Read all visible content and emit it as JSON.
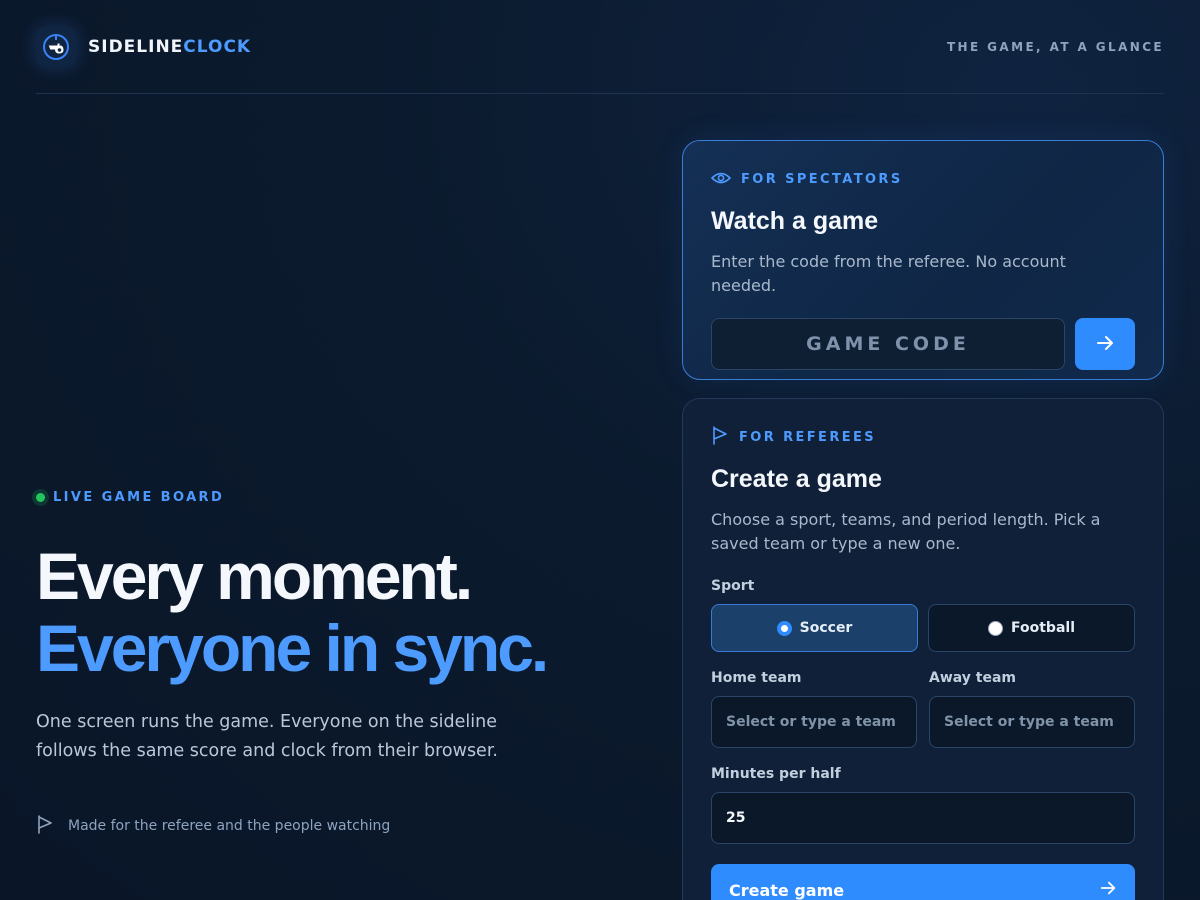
{
  "header": {
    "brand_part1": "SIDELINE",
    "brand_part2": "CLOCK",
    "tagline": "THE GAME, AT A GLANCE"
  },
  "hero": {
    "eyebrow": "LIVE GAME BOARD",
    "title_line1": "Every moment.",
    "title_line2": "Everyone in sync.",
    "description": "One screen runs the game. Everyone on the sideline follows the same score and clock from their browser.",
    "footnote": "Made for the referee and the people watching"
  },
  "spectators": {
    "label": "FOR SPECTATORS",
    "title": "Watch a game",
    "description": "Enter the code from the referee. No account needed.",
    "code_placeholder": "GAME CODE",
    "code_value": ""
  },
  "referees": {
    "label": "FOR REFEREES",
    "title": "Create a game",
    "description": "Choose a sport, teams, and period length. Pick a saved team or type a new one.",
    "sport_label": "Sport",
    "sports": [
      {
        "label": "Soccer",
        "selected": true
      },
      {
        "label": "Football",
        "selected": false
      }
    ],
    "home_label": "Home team",
    "home_placeholder": "Select or type a team",
    "away_label": "Away team",
    "away_placeholder": "Select or type a team",
    "minutes_label": "Minutes per half",
    "minutes_value": "25",
    "create_label": "Create game"
  },
  "icons": {
    "logo": "whistle-icon",
    "spectators": "eye-icon",
    "referees": "flag-icon",
    "submit": "arrow-right-icon",
    "live": "live-dot"
  },
  "colors": {
    "accent": "#2f8cff",
    "brand_blue": "#4d9bff",
    "live_green": "#22c55e",
    "background": "#0a1628"
  }
}
